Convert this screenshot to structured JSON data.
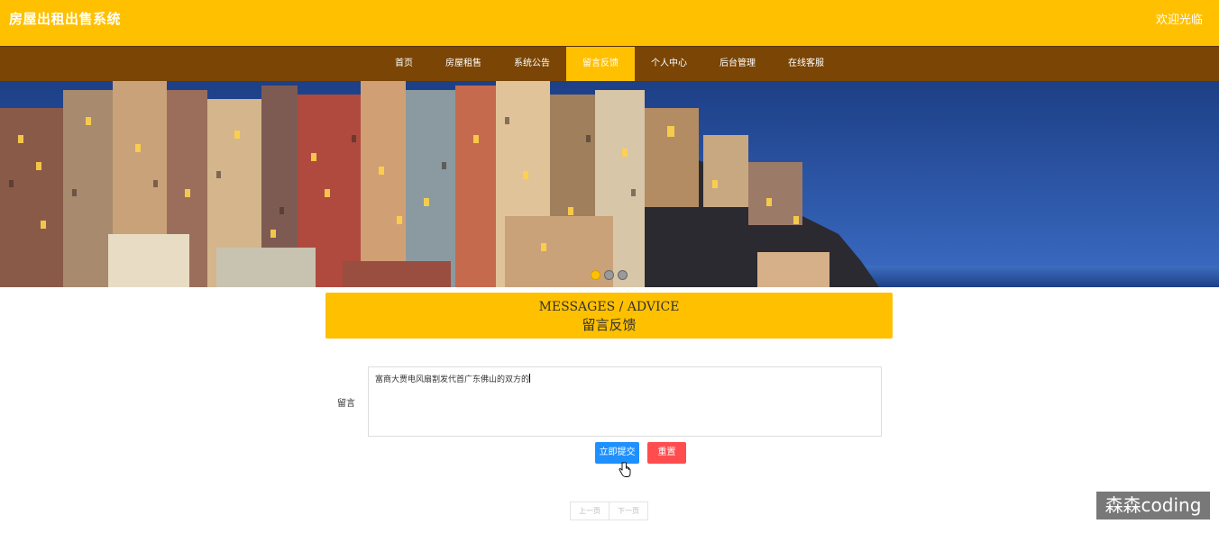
{
  "header": {
    "site_title": "房屋出租出售系统",
    "welcome_text": "欢迎光临"
  },
  "nav": {
    "items": [
      {
        "label": "首页"
      },
      {
        "label": "房屋租售"
      },
      {
        "label": "系统公告"
      },
      {
        "label": "留言反馈",
        "active": true
      },
      {
        "label": "个人中心"
      },
      {
        "label": "后台管理"
      },
      {
        "label": "在线客服"
      }
    ]
  },
  "banner": {
    "slide_count": 3,
    "active_slide": 1
  },
  "section": {
    "title_en": "MESSAGES / ADVICE",
    "title_cn": "留言反馈"
  },
  "form": {
    "message_label": "留言",
    "message_value": "富商大贾电风扇割发代首广东佛山的双方的",
    "submit_label": "立即提交",
    "reset_label": "重置"
  },
  "pagination": {
    "prev_label": "上一页",
    "next_label": "下一页"
  },
  "watermark": {
    "text": "森森coding"
  },
  "colors": {
    "brand_yellow": "#FFC000",
    "nav_brown": "#7A4505",
    "submit_blue": "#1E90FF",
    "reset_red": "#FF4D4F"
  }
}
